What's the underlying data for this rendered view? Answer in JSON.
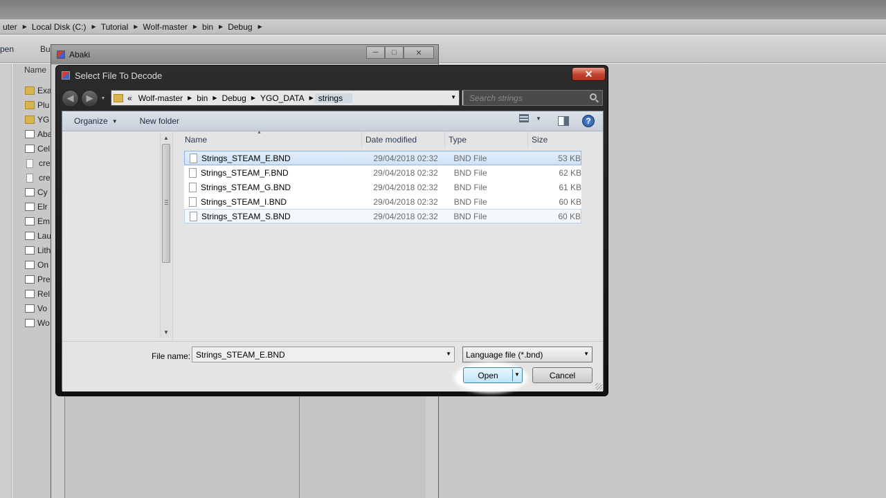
{
  "explorer": {
    "breadcrumbs": [
      "uter",
      "Local Disk (C:)",
      "Tutorial",
      "Wolf-master",
      "bin",
      "Debug"
    ],
    "toolbar": {
      "open_label": "pen",
      "burn_label": "Burn"
    },
    "name_header": "Name",
    "rows": [
      {
        "label": "Exa",
        "kind": "folder"
      },
      {
        "label": "Plu",
        "kind": "folder"
      },
      {
        "label": "YG",
        "kind": "folder"
      },
      {
        "label": "Aba",
        "kind": "app"
      },
      {
        "label": "Cel",
        "kind": "app"
      },
      {
        "label": "cre",
        "kind": "doc"
      },
      {
        "label": "cre",
        "kind": "doc"
      },
      {
        "label": "Cy",
        "kind": "app"
      },
      {
        "label": "Elr",
        "kind": "app"
      },
      {
        "label": "Em",
        "kind": "app"
      },
      {
        "label": "Lau",
        "kind": "app"
      },
      {
        "label": "Lith",
        "kind": "app"
      },
      {
        "label": "On",
        "kind": "app"
      },
      {
        "label": "Pre",
        "kind": "app"
      },
      {
        "label": "Rel",
        "kind": "app"
      },
      {
        "label": "Vo",
        "kind": "app"
      },
      {
        "label": "Wo",
        "kind": "app"
      }
    ]
  },
  "abaki": {
    "title": "Abaki",
    "controls": {
      "minimize": "─",
      "maximize": "□",
      "close": "✕"
    }
  },
  "dialog": {
    "title": "Select File To Decode",
    "close_label": "✕",
    "path": {
      "prefix": "«",
      "crumbs": [
        "Wolf-master",
        "bin",
        "Debug",
        "YGO_DATA",
        "strings"
      ]
    },
    "search_placeholder": "Search strings",
    "toolbar": {
      "organize_label": "Organize",
      "new_folder_label": "New folder",
      "help_label": "?"
    },
    "columns": {
      "name": "Name",
      "date": "Date modified",
      "type": "Type",
      "size": "Size"
    },
    "files": [
      {
        "name": "Strings_STEAM_E.BND",
        "date": "29/04/2018 02:32",
        "type": "BND File",
        "size": "53 KB",
        "state": "selected"
      },
      {
        "name": "Strings_STEAM_F.BND",
        "date": "29/04/2018 02:32",
        "type": "BND File",
        "size": "62 KB",
        "state": ""
      },
      {
        "name": "Strings_STEAM_G.BND",
        "date": "29/04/2018 02:32",
        "type": "BND File",
        "size": "61 KB",
        "state": ""
      },
      {
        "name": "Strings_STEAM_I.BND",
        "date": "29/04/2018 02:32",
        "type": "BND File",
        "size": "60 KB",
        "state": ""
      },
      {
        "name": "Strings_STEAM_S.BND",
        "date": "29/04/2018 02:32",
        "type": "BND File",
        "size": "60 KB",
        "state": "sel-soft"
      }
    ],
    "footer": {
      "filename_label": "File name:",
      "filename_value": "Strings_STEAM_E.BND",
      "filetype_value": "Language file (*.bnd)",
      "open_label": "Open",
      "cancel_label": "Cancel"
    }
  },
  "icons": {
    "back": "back-arrow-icon",
    "forward": "forward-arrow-icon",
    "refresh": "refresh-icon",
    "search": "search-icon",
    "view": "view-list-icon",
    "preview": "preview-pane-icon",
    "help": "help-icon",
    "file": "document-icon"
  }
}
